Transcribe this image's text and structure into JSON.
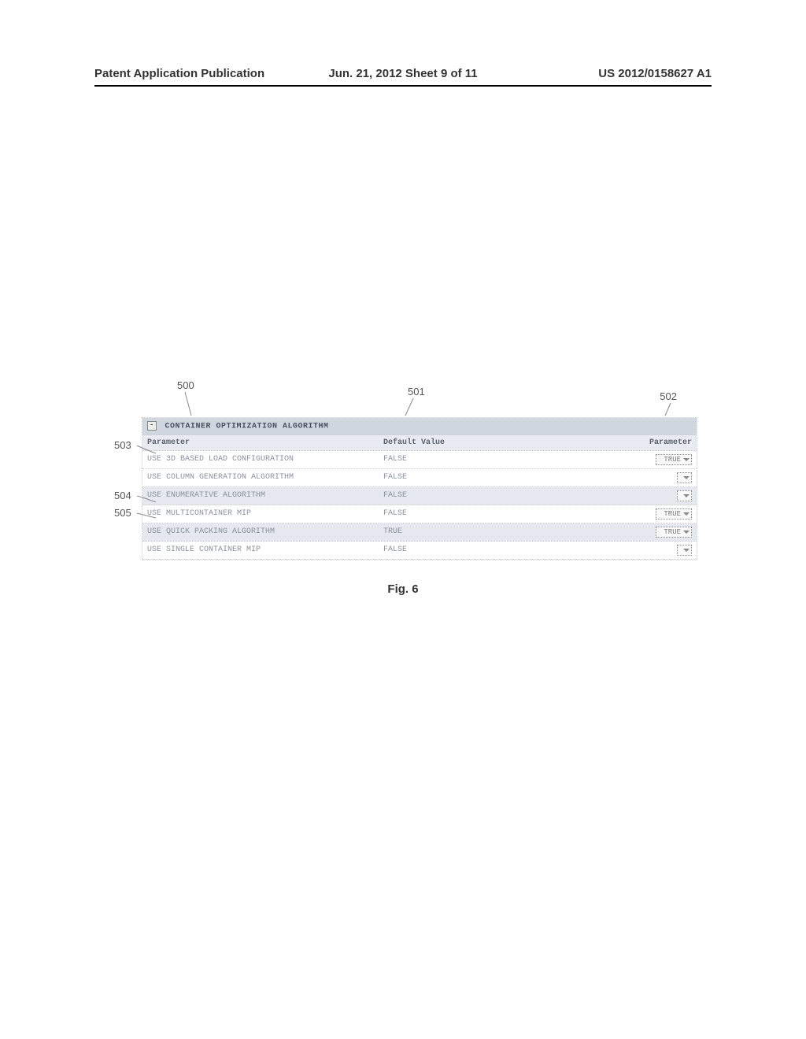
{
  "header": {
    "left": "Patent Application Publication",
    "center": "Jun. 21, 2012  Sheet 9 of 11",
    "right": "US 2012/0158627 A1"
  },
  "callouts": {
    "top": {
      "c500": "500",
      "c501": "501",
      "c502": "502"
    },
    "left": {
      "c503": "503",
      "c504": "504",
      "c505": "505"
    }
  },
  "table": {
    "section_title": "CONTAINER OPTIMIZATION ALGORITHM",
    "columns": {
      "param": "Parameter",
      "default": "Default Value",
      "value": "Parameter"
    },
    "rows": [
      {
        "param": "USE 3D BASED LOAD CONFIGURATION",
        "default": "FALSE",
        "value": "TRUE",
        "alt": false
      },
      {
        "param": "USE COLUMN GENERATION ALGORITHM",
        "default": "FALSE",
        "value": "",
        "alt": false
      },
      {
        "param": "USE ENUMERATIVE ALGORITHM",
        "default": "FALSE",
        "value": "",
        "alt": true
      },
      {
        "param": "USE MULTICONTAINER MIP",
        "default": "FALSE",
        "value": "TRUE",
        "alt": false
      },
      {
        "param": "USE QUICK PACKING ALGORITHM",
        "default": "TRUE",
        "value": "TRUE",
        "alt": true
      },
      {
        "param": "USE SINGLE CONTAINER MIP",
        "default": "FALSE",
        "value": "",
        "alt": false
      }
    ]
  },
  "caption": "Fig. 6"
}
